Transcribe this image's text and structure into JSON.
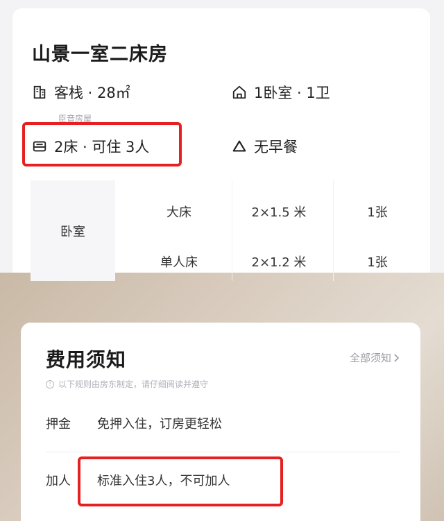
{
  "room": {
    "title": "山景一室二床房",
    "type_size": "客栈 · 28㎡",
    "type_sub": "臣音房屋",
    "layout": "1卧室 · 1卫",
    "beds_guests": "2床 · 可住 3人",
    "breakfast": "无早餐"
  },
  "bed_table": {
    "room_label": "卧室",
    "rows": [
      {
        "bed": "大床",
        "size": "2×1.5 米",
        "count": "1张"
      },
      {
        "bed": "单人床",
        "size": "2×1.2 米",
        "count": "1张"
      }
    ]
  },
  "fees": {
    "title": "费用须知",
    "all_link": "全部须知",
    "notice": "以下规则由房东制定，请仔细阅读并遵守",
    "deposit_label": "押金",
    "deposit_value": "免押入住，订房更轻松",
    "extra_label": "加人",
    "extra_value": "标准入住3人，不可加人"
  },
  "colors": {
    "highlight": "#e62020",
    "accent_text": "#222222",
    "muted_text": "#9a9aa4"
  },
  "icons": {
    "type": "building-icon",
    "layout": "house-icon",
    "beds": "bed-icon",
    "breakfast": "triangle-icon",
    "chevron": "chevron-right-icon",
    "info": "info-icon"
  }
}
